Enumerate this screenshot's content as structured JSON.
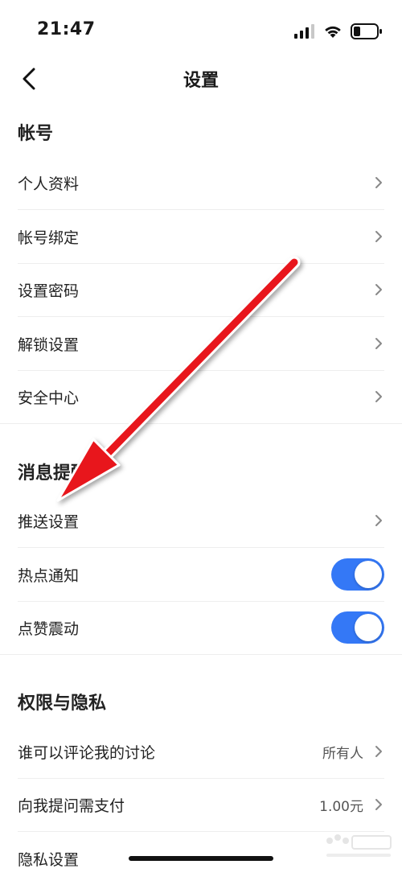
{
  "status_bar": {
    "time": "21:47"
  },
  "nav": {
    "title": "设置"
  },
  "sections": {
    "account": {
      "title": "帐号",
      "items": [
        "个人资料",
        "帐号绑定",
        "设置密码",
        "解锁设置",
        "安全中心"
      ]
    },
    "notifications": {
      "title": "消息提醒",
      "push_label": "推送设置",
      "hot_label": "热点通知",
      "hot_on": true,
      "like_label": "点赞震动",
      "like_on": true
    },
    "privacy": {
      "title": "权限与隐私",
      "comment_label": "谁可以评论我的讨论",
      "comment_value": "所有人",
      "pay_label": "向我提问需支付",
      "pay_value": "1.00元",
      "privacy_label": "隐私设置"
    }
  },
  "colors": {
    "toggle_on": "#3478f6",
    "annotation_arrow": "#e8141c"
  },
  "watermark": {
    "text": "Baidu 经验",
    "subtext": "jingyan.baidu.com"
  }
}
